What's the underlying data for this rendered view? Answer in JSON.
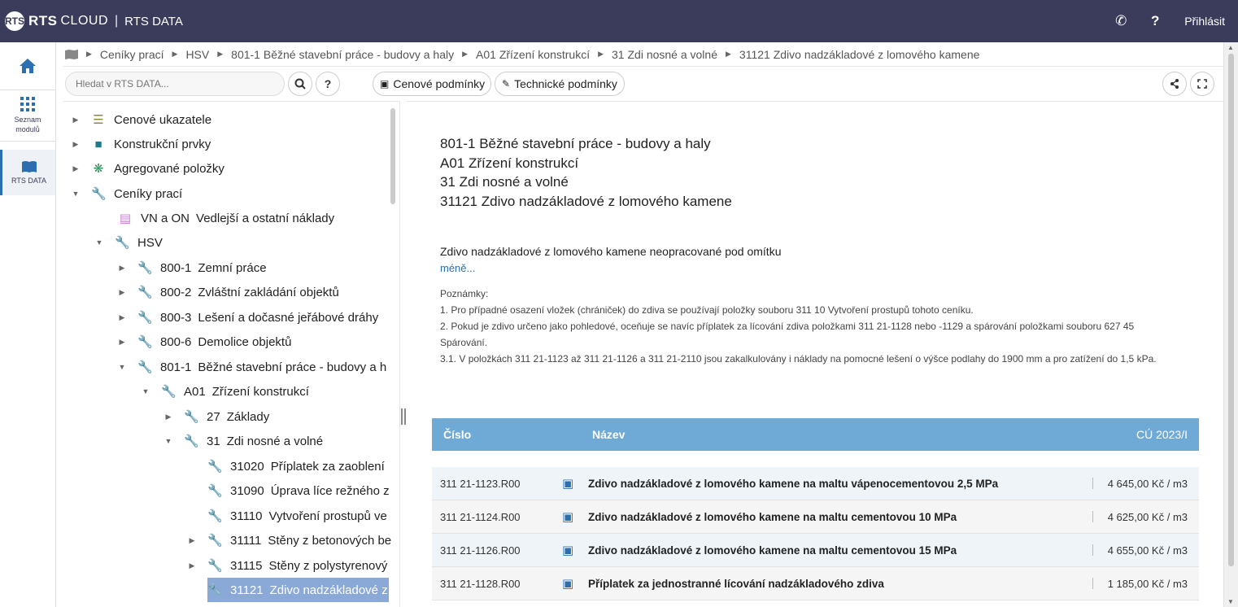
{
  "topbar": {
    "logo_badge": "RTS",
    "logo_rts": "RTS",
    "logo_cloud": "CLOUD",
    "separator": "|",
    "app_title": "RTS DATA",
    "phone_icon": "phone-icon",
    "help": "?",
    "login": "Přihlásit"
  },
  "rail": {
    "modules_label": "Seznam modulů",
    "rts_label": "RTS DATA"
  },
  "breadcrumb": [
    "Ceníky prací",
    "HSV",
    "801-1 Běžné stavební práce - budovy a haly",
    "A01 Zřízení konstrukcí",
    "31 Zdi nosné a volné",
    "31121 Zdivo nadzákladové z lomového kamene"
  ],
  "toolbar": {
    "search_placeholder": "Hledat v RTS DATA...",
    "help": "?",
    "price_conditions": "Cenové podmínky",
    "tech_conditions": "Technické podmínky"
  },
  "tree": [
    {
      "label": "Cenové ukazatele",
      "arrow": "▶"
    },
    {
      "label": "Konstrukční prvky",
      "arrow": "▶"
    },
    {
      "label": "Agregované položky",
      "arrow": "▶"
    },
    {
      "label": "Ceníky prací",
      "arrow": "▼"
    },
    {
      "code": "VN a ON",
      "label": "Vedlejší a ostatní náklady",
      "arrow": ""
    },
    {
      "label": "HSV",
      "arrow": "▼"
    },
    {
      "code": "800-1",
      "label": "Zemní práce",
      "arrow": "▶"
    },
    {
      "code": "800-2",
      "label": "Zvláštní zakládání objektů",
      "arrow": "▶"
    },
    {
      "code": "800-3",
      "label": "Lešení a dočasné jeřábové dráhy",
      "arrow": "▶"
    },
    {
      "code": "800-6",
      "label": "Demolice objektů",
      "arrow": "▶"
    },
    {
      "code": "801-1",
      "label": "Běžné stavební práce - budovy a h",
      "arrow": "▼"
    },
    {
      "code": "A01",
      "label": "Zřízení konstrukcí",
      "arrow": "▼"
    },
    {
      "code": "27",
      "label": "Základy",
      "arrow": "▶"
    },
    {
      "code": "31",
      "label": "Zdi nosné a volné",
      "arrow": "▼"
    },
    {
      "code": "31020",
      "label": "Příplatek za zaoblení",
      "arrow": ""
    },
    {
      "code": "31090",
      "label": "Úprava líce režného z",
      "arrow": ""
    },
    {
      "code": "31110",
      "label": "Vytvoření prostupů ve",
      "arrow": ""
    },
    {
      "code": "31111",
      "label": "Stěny z betonových be",
      "arrow": "▶"
    },
    {
      "code": "31115",
      "label": "Stěny z polystyrenový",
      "arrow": "▶"
    },
    {
      "code": "31121",
      "label": "Zdivo nadzákladové z",
      "arrow": ""
    }
  ],
  "content": {
    "heading": [
      "801-1 Běžné stavební práce - budovy a haly",
      "A01 Zřízení konstrukcí",
      "31 Zdi nosné a volné",
      "31121 Zdivo nadzákladové z lomového kamene"
    ],
    "description": "Zdivo nadzákladové z lomového kamene neopracované pod omítku",
    "less_link": "méně...",
    "notes_title": "Poznámky:",
    "notes": [
      "1. Pro případné osazení vložek (chrániček) do zdiva se používají položky souboru 311 10 Vytvoření prostupů tohoto ceníku.",
      "2. Pokud je zdivo určeno jako pohledové, oceňuje se navíc příplatek za lícování zdiva položkami 311 21-1128 nebo -1129 a spárování položkami souboru 627 45 Spárování.",
      "3.1. V položkách 311 21-1123 až 311 21-1126 a 311 21-2110 jsou zakalkulovány i náklady na pomocné lešení o výšce podlahy do 1900 mm a pro zatížení do 1,5 kPa."
    ]
  },
  "table": {
    "headers": {
      "number": "Číslo",
      "name": "Název",
      "price": "CÚ 2023/I"
    },
    "rows": [
      {
        "number": "311 21-1123.R00",
        "name": "Zdivo nadzákladové z lomového kamene na maltu vápenocementovou 2,5 MPa",
        "price": "4 645,00 Kč / m3"
      },
      {
        "number": "311 21-1124.R00",
        "name": "Zdivo nadzákladové z lomového kamene na maltu cementovou 10 MPa",
        "price": "4 625,00 Kč / m3"
      },
      {
        "number": "311 21-1126.R00",
        "name": "Zdivo nadzákladové z lomového kamene na maltu cementovou 15 MPa",
        "price": "4 655,00 Kč / m3"
      },
      {
        "number": "311 21-1128.R00",
        "name": "Příplatek za jednostranné lícování nadzákladového zdiva",
        "price": "1 185,00 Kč / m3"
      }
    ]
  }
}
